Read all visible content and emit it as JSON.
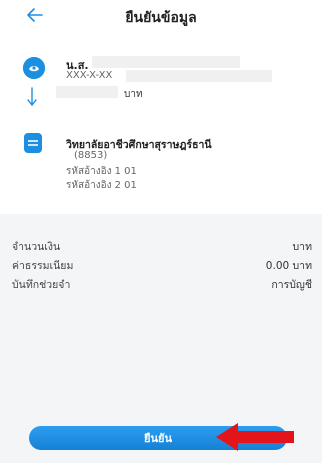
{
  "header": {
    "title": "ยืนยันข้อมูล",
    "back_icon": "arrow-left-icon"
  },
  "sender": {
    "name_prefix": "น.ส.",
    "account": "XXX-X-XX",
    "amount_unit": "บาท"
  },
  "receiver": {
    "name": "วิทยาลัยอาชีวศึกษาสุราษฎร์ธานี",
    "code": "(8853)",
    "ref1": "รหัสอ้างอิง 1 01",
    "ref2": "รหัสอ้างอิง 2 01"
  },
  "details": {
    "amount_label": "จำนวนเงิน",
    "amount_value": "บาท",
    "fee_label": "ค่าธรรมเนียม",
    "fee_value": "0.00 บาท",
    "memo_label": "บันทึกช่วยจำ",
    "memo_value": "การบัญชี"
  },
  "confirm_button": {
    "label": "ยืนยัน"
  },
  "colors": {
    "accent": "#1d8fe1",
    "annotation_arrow": "#e3151a"
  }
}
